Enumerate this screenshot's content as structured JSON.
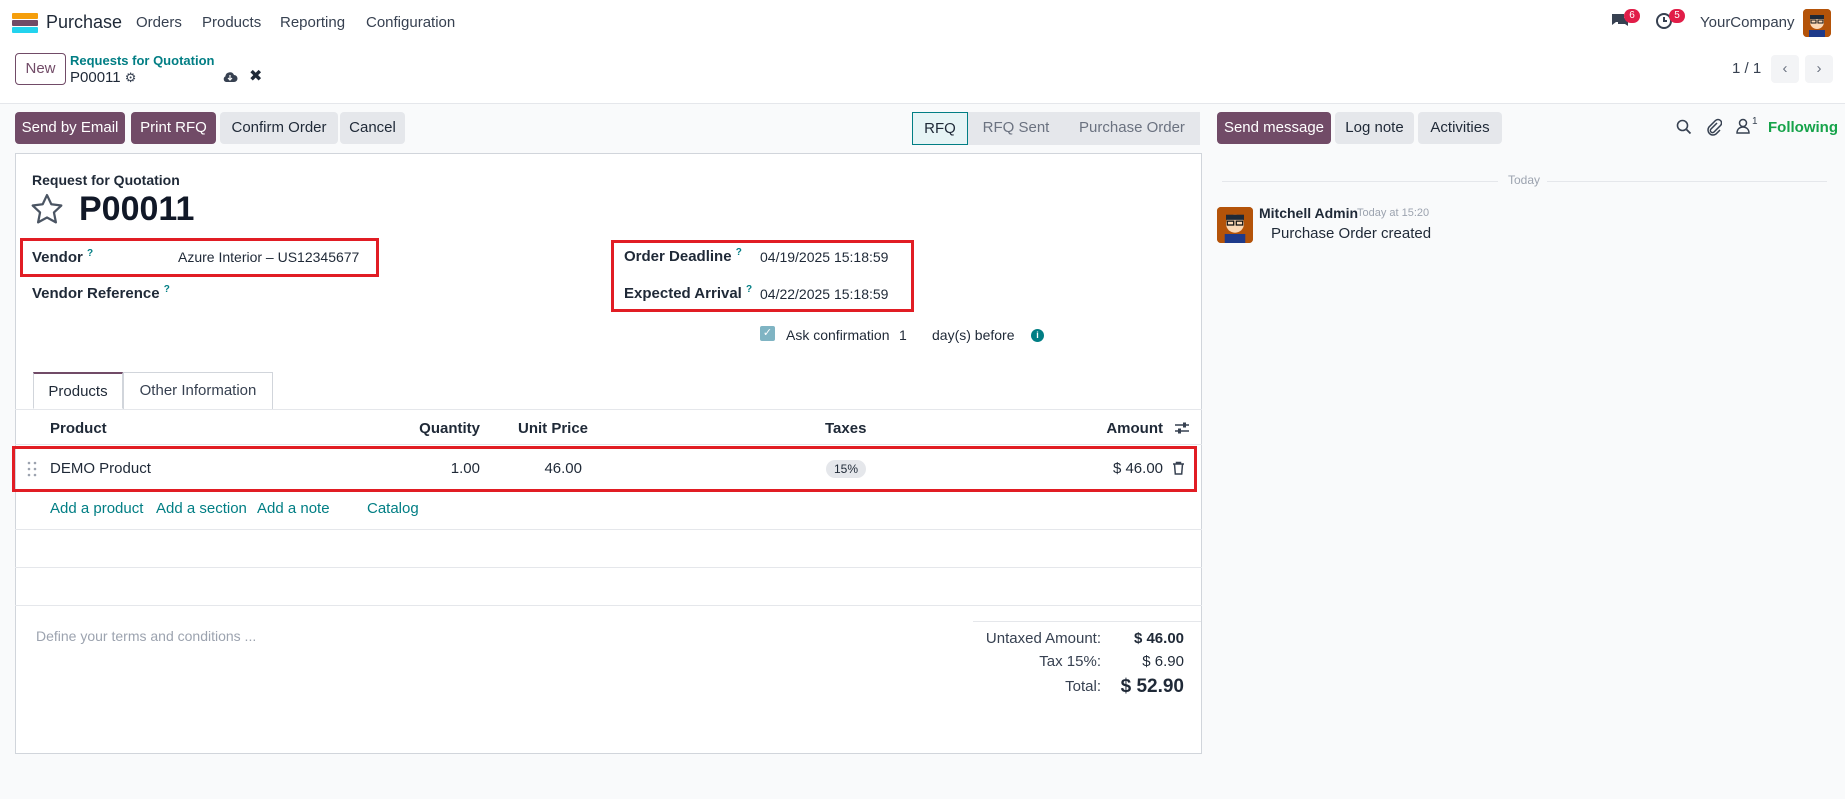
{
  "nav": {
    "app_name": "Purchase",
    "menu": [
      "Orders",
      "Products",
      "Reporting",
      "Configuration"
    ],
    "messages_count": "6",
    "activities_count": "5",
    "company": "YourCompany"
  },
  "control": {
    "new_label": "New",
    "breadcrumb_parent": "Requests for Quotation",
    "breadcrumb_current": "P00011",
    "pager": "1 / 1"
  },
  "actions": {
    "send_email": "Send by Email",
    "print_rfq": "Print RFQ",
    "confirm_order": "Confirm Order",
    "cancel": "Cancel"
  },
  "statusbar": {
    "steps": [
      "RFQ",
      "RFQ Sent",
      "Purchase Order"
    ],
    "active": "RFQ"
  },
  "form": {
    "doc_type": "Request for Quotation",
    "doc_name": "P00011",
    "vendor_label": "Vendor",
    "vendor_value": "Azure Interior – US12345677",
    "vendor_ref_label": "Vendor Reference",
    "vendor_ref_value": "",
    "order_deadline_label": "Order Deadline",
    "order_deadline_value": "04/19/2025 15:18:59",
    "expected_arrival_label": "Expected Arrival",
    "expected_arrival_value": "04/22/2025 15:18:59",
    "ask_confirmation_label": "Ask confirmation",
    "ask_confirmation_days": "1",
    "days_before_label": "day(s) before"
  },
  "tabs": [
    "Products",
    "Other Information"
  ],
  "table": {
    "headers": {
      "product": "Product",
      "quantity": "Quantity",
      "unit_price": "Unit Price",
      "taxes": "Taxes",
      "amount": "Amount"
    },
    "rows": [
      {
        "product": "DEMO Product",
        "quantity": "1.00",
        "unit_price": "46.00",
        "taxes": "15%",
        "amount": "$ 46.00"
      }
    ],
    "add_product": "Add a product",
    "add_section": "Add a section",
    "add_note": "Add a note",
    "catalog": "Catalog"
  },
  "totals": {
    "terms_placeholder": "Define your terms and conditions ...",
    "untaxed_label": "Untaxed Amount:",
    "untaxed_value": "$ 46.00",
    "tax_label": "Tax 15%:",
    "tax_value": "$ 6.90",
    "total_label": "Total:",
    "total_value": "$ 52.90"
  },
  "chatter": {
    "send_message": "Send message",
    "log_note": "Log note",
    "activities": "Activities",
    "followers_count": "1",
    "following": "Following",
    "date_separator": "Today",
    "messages": [
      {
        "author": "Mitchell Admin",
        "time": "Today at 15:20",
        "body": "Purchase Order created"
      }
    ]
  },
  "colors": {
    "brand": "#714b67",
    "link": "#017e84",
    "highlight": "#e11d24",
    "following": "#16a34a"
  }
}
